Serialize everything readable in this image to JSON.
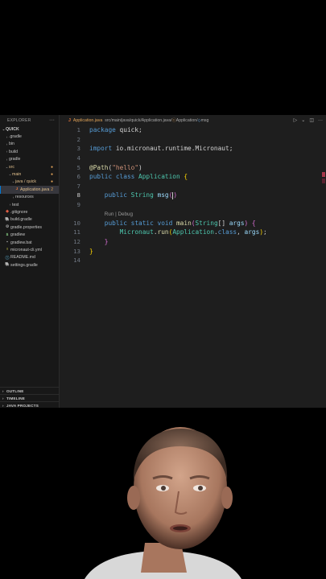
{
  "explorer": {
    "title": "EXPLORER",
    "menu_glyph": "···",
    "tree": [
      {
        "label": "QUICK",
        "chev": "⌄",
        "depth": 0,
        "kind": "root"
      },
      {
        "label": ".gradle",
        "chev": "›",
        "depth": 1,
        "kind": "folder"
      },
      {
        "label": "bin",
        "chev": "›",
        "depth": 1,
        "kind": "folder"
      },
      {
        "label": "build",
        "chev": "›",
        "depth": 1,
        "kind": "folder"
      },
      {
        "label": "gradle",
        "chev": "›",
        "depth": 1,
        "kind": "folder"
      },
      {
        "label": "src",
        "chev": "⌄",
        "depth": 1,
        "kind": "folder-mod",
        "badge": "●"
      },
      {
        "label": "main",
        "chev": "⌄",
        "depth": 2,
        "kind": "folder-mod",
        "badge": "●"
      },
      {
        "label": "java / quick",
        "chev": "⌄",
        "depth": 3,
        "kind": "folder-mod",
        "badge": "●"
      },
      {
        "label": "Application.java",
        "icon": "J",
        "depth": 4,
        "kind": "file-mod",
        "badge": "2",
        "active": true
      },
      {
        "label": "resources",
        "chev": "›",
        "depth": 3,
        "kind": "folder"
      },
      {
        "label": "test",
        "chev": "›",
        "depth": 2,
        "kind": "folder"
      },
      {
        "label": ".gitignore",
        "icon": "◆",
        "depth": 1,
        "kind": "file"
      },
      {
        "label": "build.gradle",
        "icon": "🐘",
        "depth": 1,
        "kind": "file"
      },
      {
        "label": "gradle.properties",
        "icon": "⚙",
        "depth": 1,
        "kind": "file"
      },
      {
        "label": "gradlew",
        "icon": "$",
        "depth": 1,
        "kind": "file"
      },
      {
        "label": "gradlew.bat",
        "icon": "▪",
        "depth": 1,
        "kind": "file"
      },
      {
        "label": "micronaut-cli.yml",
        "icon": "!",
        "depth": 1,
        "kind": "file"
      },
      {
        "label": "README.md",
        "icon": "ⓘ",
        "depth": 1,
        "kind": "file"
      },
      {
        "label": "settings.gradle",
        "icon": "🐘",
        "depth": 1,
        "kind": "file"
      }
    ],
    "sections": [
      {
        "label": "OUTLINE"
      },
      {
        "label": "TIMELINE"
      },
      {
        "label": "JAVA PROJECTS"
      }
    ]
  },
  "editor": {
    "tab": {
      "icon_letter": "J",
      "file": "Application.java",
      "breadcrumb": "src/main/java/quick/Application.java/",
      "crumb_class": "Application",
      "crumb_field": "msg"
    },
    "actions": [
      "▷",
      "⌄",
      "◫",
      "···"
    ],
    "code_lens": "Run | Debug"
  },
  "colors": {
    "editor_bg": "#1e1e1e",
    "sidebar_bg": "#181818",
    "keyword": "#569cd6",
    "type": "#4ec9b0",
    "string": "#ce9178",
    "modified": "#e2a458"
  }
}
